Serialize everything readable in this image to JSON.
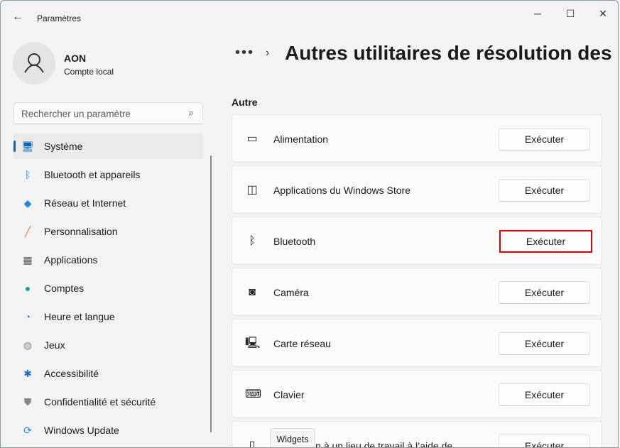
{
  "window": {
    "title": "Paramètres",
    "back_icon": "←",
    "minimize": "─",
    "maximize": "☐",
    "close": "✕"
  },
  "user": {
    "name": "AON",
    "subtitle": "Compte local"
  },
  "search": {
    "placeholder": "Rechercher un paramètre"
  },
  "nav": [
    {
      "label": "Système",
      "icon": "🖥",
      "color": "#0067c0",
      "selected": true
    },
    {
      "label": "Bluetooth et appareils",
      "icon": "ᛒ",
      "color": "#1e88e5"
    },
    {
      "label": "Réseau et Internet",
      "icon": "◆",
      "color": "#1e88e5"
    },
    {
      "label": "Personnalisation",
      "icon": "╱",
      "color": "#e07b39"
    },
    {
      "label": "Applications",
      "icon": "▦",
      "color": "#555"
    },
    {
      "label": "Comptes",
      "icon": "●",
      "color": "#1aa39a"
    },
    {
      "label": "Heure et langue",
      "icon": "◔",
      "color": "#1e88e5"
    },
    {
      "label": "Jeux",
      "icon": "◍",
      "color": "#888"
    },
    {
      "label": "Accessibilité",
      "icon": "✱",
      "color": "#1e70c8"
    },
    {
      "label": "Confidentialité et sécurité",
      "icon": "⛊",
      "color": "#888"
    },
    {
      "label": "Windows Update",
      "icon": "⟳",
      "color": "#1e88e5"
    }
  ],
  "header": {
    "breadcrumb_more": "•••",
    "chevron": "›",
    "title": "Autres utilitaires de résolution des problèmes"
  },
  "section": "Autre",
  "items": [
    {
      "label": "Alimentation",
      "icon": "▭",
      "button": "Exécuter"
    },
    {
      "label": "Applications du Windows Store",
      "icon": "◫",
      "button": "Exécuter"
    },
    {
      "label": "Bluetooth",
      "icon": "ᛒ",
      "button": "Exécuter",
      "highlighted": true
    },
    {
      "label": "Caméra",
      "icon": "◙",
      "button": "Exécuter"
    },
    {
      "label": "Carte réseau",
      "icon": "🖳",
      "button": "Exécuter"
    },
    {
      "label": "Clavier",
      "icon": "⌨",
      "button": "Exécuter"
    },
    {
      "label": "Connexion à un lieu de travail à l’aide de",
      "icon": "▯",
      "button": "Exécuter"
    }
  ],
  "tooltip": "Widgets"
}
